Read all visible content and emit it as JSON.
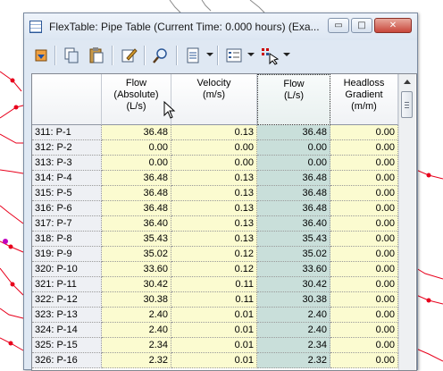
{
  "window": {
    "title": "FlexTable: Pipe Table (Current Time: 0.000 hours) (Exa...",
    "minimize_glyph": "▭",
    "maximize_glyph": "□",
    "close_glyph": "✕"
  },
  "toolbar": {
    "buttons": [
      "open-icon",
      "copy-icon",
      "paste-icon",
      "edit-icon",
      "zoom-icon",
      "report-icon",
      "options-icon",
      "select-icon"
    ]
  },
  "columns": [
    {
      "key": "label",
      "header": ""
    },
    {
      "key": "flow_abs",
      "header_lines": [
        "Flow",
        "(Absolute)",
        "(L/s)"
      ]
    },
    {
      "key": "velocity",
      "header_lines": [
        "Velocity",
        "(m/s)"
      ]
    },
    {
      "key": "flow",
      "header_lines": [
        "Flow",
        "(L/s)"
      ]
    },
    {
      "key": "headloss",
      "header_lines": [
        "Headloss",
        "Gradient",
        "(m/m)"
      ]
    }
  ],
  "rows": [
    {
      "label": "311: P-1",
      "flow_abs": "36.48",
      "velocity": "0.13",
      "flow": "36.48",
      "headloss": "0.00"
    },
    {
      "label": "312: P-2",
      "flow_abs": "0.00",
      "velocity": "0.00",
      "flow": "0.00",
      "headloss": "0.00"
    },
    {
      "label": "313: P-3",
      "flow_abs": "0.00",
      "velocity": "0.00",
      "flow": "0.00",
      "headloss": "0.00"
    },
    {
      "label": "314: P-4",
      "flow_abs": "36.48",
      "velocity": "0.13",
      "flow": "36.48",
      "headloss": "0.00"
    },
    {
      "label": "315: P-5",
      "flow_abs": "36.48",
      "velocity": "0.13",
      "flow": "36.48",
      "headloss": "0.00"
    },
    {
      "label": "316: P-6",
      "flow_abs": "36.48",
      "velocity": "0.13",
      "flow": "36.48",
      "headloss": "0.00"
    },
    {
      "label": "317: P-7",
      "flow_abs": "36.40",
      "velocity": "0.13",
      "flow": "36.40",
      "headloss": "0.00"
    },
    {
      "label": "318: P-8",
      "flow_abs": "35.43",
      "velocity": "0.13",
      "flow": "35.43",
      "headloss": "0.00"
    },
    {
      "label": "319: P-9",
      "flow_abs": "35.02",
      "velocity": "0.12",
      "flow": "35.02",
      "headloss": "0.00"
    },
    {
      "label": "320: P-10",
      "flow_abs": "33.60",
      "velocity": "0.12",
      "flow": "33.60",
      "headloss": "0.00"
    },
    {
      "label": "321: P-11",
      "flow_abs": "30.42",
      "velocity": "0.11",
      "flow": "30.42",
      "headloss": "0.00"
    },
    {
      "label": "322: P-12",
      "flow_abs": "30.38",
      "velocity": "0.11",
      "flow": "30.38",
      "headloss": "0.00"
    },
    {
      "label": "323: P-13",
      "flow_abs": "2.40",
      "velocity": "0.01",
      "flow": "2.40",
      "headloss": "0.00"
    },
    {
      "label": "324: P-14",
      "flow_abs": "2.40",
      "velocity": "0.01",
      "flow": "2.40",
      "headloss": "0.00"
    },
    {
      "label": "325: P-15",
      "flow_abs": "2.34",
      "velocity": "0.01",
      "flow": "2.34",
      "headloss": "0.00"
    },
    {
      "label": "326: P-16",
      "flow_abs": "2.32",
      "velocity": "0.01",
      "flow": "2.32",
      "headloss": "0.00"
    }
  ],
  "colors": {
    "editable_cell": "#fbfbd0",
    "selected_column": "#c9dfda",
    "row_header": "#eef0f4",
    "network_lines": "#e8001c"
  }
}
